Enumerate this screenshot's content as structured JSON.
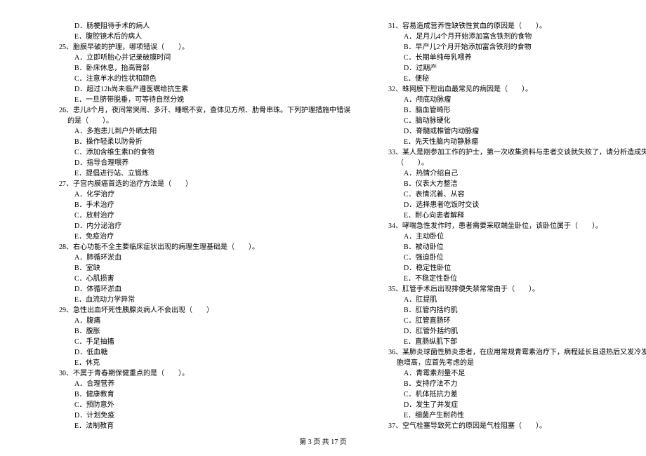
{
  "left_column": [
    {
      "cls": "option",
      "text": "D．肠梗阻待手术的病人"
    },
    {
      "cls": "option",
      "text": "E．腹腔镜术后的病人"
    },
    {
      "cls": "question",
      "text": "25、胎膜早破的护理，哪项错误（　　）。"
    },
    {
      "cls": "option",
      "text": "A．立即听胎心并记录破膜时间"
    },
    {
      "cls": "option",
      "text": "B．卧床休息，抬高臀部"
    },
    {
      "cls": "option",
      "text": "C．注意羊水的性状和颜色"
    },
    {
      "cls": "option",
      "text": "D．超过12h尚未临产遵医嘱给抗生素"
    },
    {
      "cls": "option",
      "text": "E．一旦脐带脱垂，可等待自然分娩"
    },
    {
      "cls": "question",
      "text": "26、患儿8个月，夜间常哭闹、多汗、睡眠不安，查体见方颅、肋骨串珠。下列护理措施中错误"
    },
    {
      "cls": "question-sub",
      "text": "的是（　　）。"
    },
    {
      "cls": "option",
      "text": "A．多抱患儿到户外晒太阳"
    },
    {
      "cls": "option",
      "text": "B．操作轻柔以防骨折"
    },
    {
      "cls": "option",
      "text": "C．添加含维生素D的食物"
    },
    {
      "cls": "option",
      "text": "D．指导合理喂养"
    },
    {
      "cls": "option",
      "text": "E．提倡进行站、立锻炼"
    },
    {
      "cls": "question",
      "text": "27、子宫内膜癌首选的治疗方法是（　　）"
    },
    {
      "cls": "option",
      "text": "A．化学治疗"
    },
    {
      "cls": "option",
      "text": "B．手术治疗"
    },
    {
      "cls": "option",
      "text": "C．放射治疗"
    },
    {
      "cls": "option",
      "text": "D．内分泌治疗"
    },
    {
      "cls": "option",
      "text": "E．免疫治疗"
    },
    {
      "cls": "question",
      "text": "28、右心功能不全主要临床症状出现的病理生理基础是（　　）。"
    },
    {
      "cls": "option",
      "text": "A．肺循环淤血"
    },
    {
      "cls": "option",
      "text": "B．室缺"
    },
    {
      "cls": "option",
      "text": "C．心肌损害"
    },
    {
      "cls": "option",
      "text": "D．体循环淤血"
    },
    {
      "cls": "option",
      "text": "E．血流动力学异常"
    },
    {
      "cls": "question",
      "text": "29、急性出血坏死性胰腺炎病人不会出现（　　）"
    },
    {
      "cls": "option",
      "text": "A．腹痛"
    },
    {
      "cls": "option",
      "text": "B．腹胀"
    },
    {
      "cls": "option",
      "text": "C．手足抽搐"
    },
    {
      "cls": "option",
      "text": "D．低血糖"
    },
    {
      "cls": "option",
      "text": "E．休克"
    },
    {
      "cls": "question",
      "text": "30、不属于青春期保健重点的是（　　）。"
    },
    {
      "cls": "option",
      "text": "A．合理营养"
    },
    {
      "cls": "option",
      "text": "B．健康教育"
    },
    {
      "cls": "option",
      "text": "C．预防意外"
    },
    {
      "cls": "option",
      "text": "D．计划免疫"
    },
    {
      "cls": "option",
      "text": "E．法制教育"
    }
  ],
  "right_column": [
    {
      "cls": "question",
      "text": "31、容易造成营养性缺铁性贫血的原因是（　　）。"
    },
    {
      "cls": "option",
      "text": "A．足月儿4个月开始添加富含铁剂的食物"
    },
    {
      "cls": "option",
      "text": "B．早产儿2个月开始添加富含铁剂的食物"
    },
    {
      "cls": "option",
      "text": "C．长期单纯母乳喂养"
    },
    {
      "cls": "option",
      "text": "D．过期产"
    },
    {
      "cls": "option",
      "text": "E．便秘"
    },
    {
      "cls": "question",
      "text": "32、蛛网膜下腔出血最常见的病因是（　　）。"
    },
    {
      "cls": "option",
      "text": "A．颅底动脉瘤"
    },
    {
      "cls": "option",
      "text": "B．脑血管畸形"
    },
    {
      "cls": "option",
      "text": "C．脑动脉硬化"
    },
    {
      "cls": "option",
      "text": "D．脊髓或椎管内动脉瘤"
    },
    {
      "cls": "option",
      "text": "E．先天性脑内动静脉瘤"
    },
    {
      "cls": "question",
      "text": "33、某人是刚参加工作的护士，第一次收集资料与患者交谈就失败了，请分析造成失败的原因"
    },
    {
      "cls": "question-sub",
      "text": "（　　）。"
    },
    {
      "cls": "option",
      "text": "A．热情介绍自己"
    },
    {
      "cls": "option",
      "text": "B．仪表大方整洁"
    },
    {
      "cls": "option",
      "text": "C．表情沉着、从容"
    },
    {
      "cls": "option",
      "text": "D．选择患者吃饭时交谈"
    },
    {
      "cls": "option",
      "text": "E．耐心向患者解释"
    },
    {
      "cls": "question",
      "text": "34、哮喘急性发作时，患者需要采取端坐卧位，该卧位属于（　　）。"
    },
    {
      "cls": "option",
      "text": "A．主动卧位"
    },
    {
      "cls": "option",
      "text": "B．被动卧位"
    },
    {
      "cls": "option",
      "text": "C．强迫卧位"
    },
    {
      "cls": "option",
      "text": "D．稳定性卧位"
    },
    {
      "cls": "option",
      "text": "E．不稳定性卧位"
    },
    {
      "cls": "question",
      "text": "35、肛管手术后出现排便失禁常常由于（　　）。"
    },
    {
      "cls": "option",
      "text": "A．肛提肌"
    },
    {
      "cls": "option",
      "text": "B．肛管内括约肌"
    },
    {
      "cls": "option",
      "text": "C．肛管直肠环"
    },
    {
      "cls": "option",
      "text": "D．肛管外括约肌"
    },
    {
      "cls": "option",
      "text": "E．直肠纵肌下部"
    },
    {
      "cls": "question",
      "text": "36、某肺炎球菌性肺炎患者，在应用常规青霉素治疗下，病程延长且退热后又发冷发热，白细"
    },
    {
      "cls": "question-sub",
      "text": "胞增高，应首先考虑的是"
    },
    {
      "cls": "option",
      "text": "A．青霉素剂量不足"
    },
    {
      "cls": "option",
      "text": "B．支持疗法不力"
    },
    {
      "cls": "option",
      "text": "C．机体抵抗力差"
    },
    {
      "cls": "option",
      "text": "D．发生了并发症"
    },
    {
      "cls": "option",
      "text": "E．细菌产生耐药性"
    },
    {
      "cls": "question",
      "text": "37、空气栓塞导致死亡的原因是气栓阻塞（　　）。"
    }
  ],
  "footer": "第 3 页 共 17 页"
}
